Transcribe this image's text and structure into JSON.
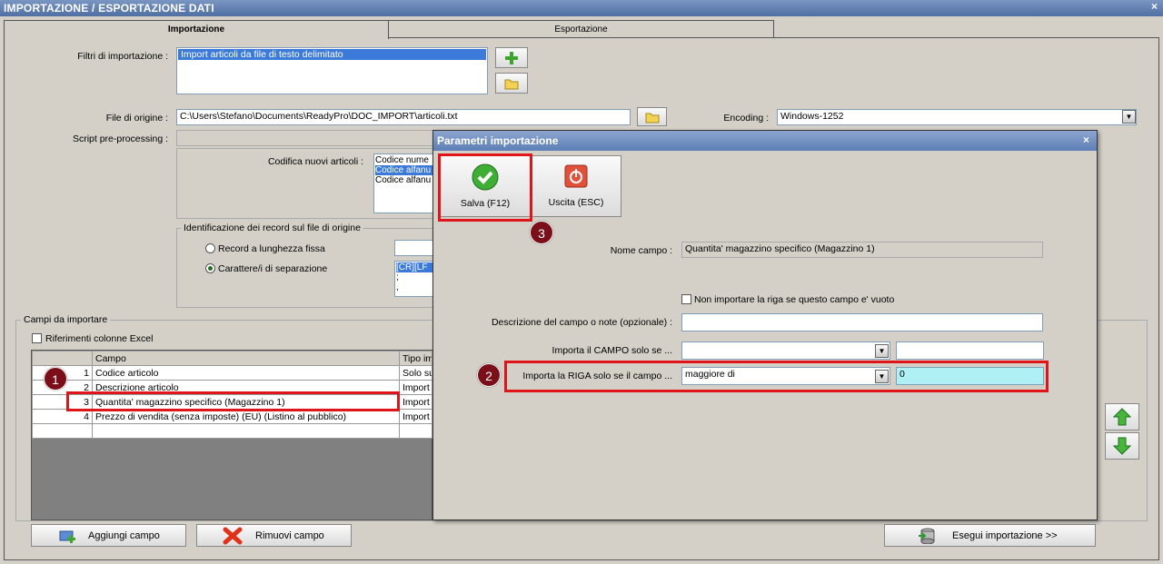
{
  "window": {
    "title": "IMPORTAZIONE / ESPORTAZIONE DATI",
    "close": "×"
  },
  "tabs": [
    {
      "label": "Importazione"
    },
    {
      "label": "Esportazione"
    }
  ],
  "main": {
    "filters_label": "Filtri di importazione :",
    "filters_items": [
      "Import articoli da file di testo delimitato"
    ],
    "origin_file_label": "File di origine :",
    "origin_file_value": "C:\\Users\\Stefano\\Documents\\ReadyPro\\DOC_IMPORT\\articoli.txt",
    "encoding_label": "Encoding :",
    "encoding_value": "Windows-1252",
    "script_label": "Script pre-processing :",
    "codifica_label": "Codifica nuovi articoli :",
    "codifica_items": [
      "Codice nume",
      "Codice alfanu",
      "Codice alfanu"
    ],
    "identification_title": "Identificazione dei record sul file di origine",
    "radio_fixed": "Record a lunghezza fissa",
    "radio_sep": "Carattere/i di separazione",
    "sep_items": [
      "[CR][LF",
      ";",
      ","
    ],
    "fields_group_title": "Campi da importare",
    "excel_ref_label": "Riferimenti colonne Excel",
    "table_headers": [
      "Campo",
      "Tipo im"
    ],
    "table_rows": [
      {
        "n": "1",
        "campo": "Codice articolo",
        "tipo": "Solo su"
      },
      {
        "n": "2",
        "campo": "Descrizione articolo",
        "tipo": "Import"
      },
      {
        "n": "3",
        "campo": "Quantita' magazzino specifico (Magazzino 1)",
        "tipo": "Import"
      },
      {
        "n": "4",
        "campo": "Prezzo di vendita (senza imposte) (EU) (Listino al pubblico)",
        "tipo": "Import"
      }
    ],
    "add_field": "Aggiungi campo",
    "remove_field": "Rimuovi campo",
    "run_import": "Esegui importazione >>"
  },
  "dialog": {
    "title": "Parametri importazione",
    "close": "×",
    "save": "Salva (F12)",
    "exit": "Uscita (ESC)",
    "field_name_label": "Nome campo :",
    "field_name_value": "Quantita' magazzino specifico (Magazzino 1)",
    "skip_empty_label": "Non importare la riga se questo campo e' vuoto",
    "desc_label": "Descrizione del campo o note (opzionale) :",
    "import_field_label": "Importa il CAMPO solo se ...",
    "import_row_label": "Importa la RIGA solo se il campo ...",
    "import_row_condition": "maggiore di",
    "import_row_value": "0"
  },
  "badges": [
    "1",
    "2",
    "3"
  ]
}
